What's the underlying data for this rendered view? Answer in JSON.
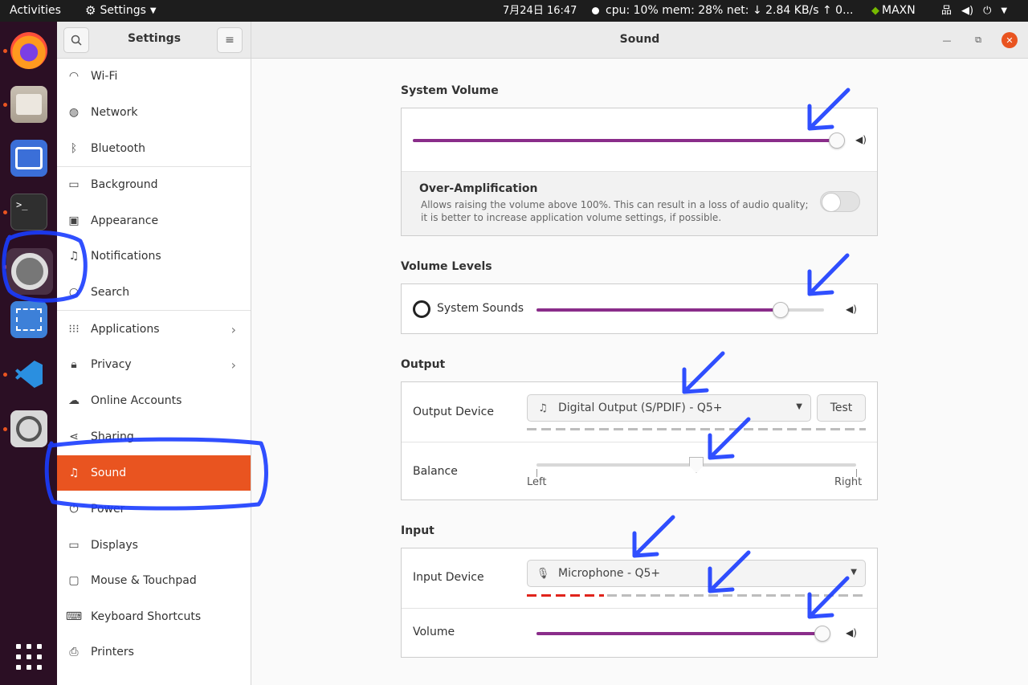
{
  "topbar": {
    "activities": "Activities",
    "app_menu": "Settings",
    "clock": "7月24日 16:47",
    "stats": "cpu: 10% mem: 28% net: ↓  2.84 KB/s ↑  0...",
    "gpu_label": "MAXN"
  },
  "dock": {
    "apps": [
      "firefox",
      "files",
      "workspaces",
      "terminal",
      "settings",
      "screenshot",
      "vscode",
      "magnifier"
    ],
    "terminal_glyph": ">_"
  },
  "sidebar": {
    "title": "Settings",
    "items": [
      {
        "label": "Wi-Fi",
        "icon": "wifi-icon"
      },
      {
        "label": "Network",
        "icon": "network-icon"
      },
      {
        "label": "Bluetooth",
        "icon": "bluetooth-icon"
      },
      {
        "label": "Background",
        "icon": "background-icon"
      },
      {
        "label": "Appearance",
        "icon": "appearance-icon"
      },
      {
        "label": "Notifications",
        "icon": "bell-icon"
      },
      {
        "label": "Search",
        "icon": "search-icon"
      },
      {
        "label": "Applications",
        "icon": "apps-icon"
      },
      {
        "label": "Privacy",
        "icon": "lock-icon"
      },
      {
        "label": "Online Accounts",
        "icon": "cloud-icon"
      },
      {
        "label": "Sharing",
        "icon": "share-icon"
      },
      {
        "label": "Sound",
        "icon": "music-icon"
      },
      {
        "label": "Power",
        "icon": "power-icon"
      },
      {
        "label": "Displays",
        "icon": "display-icon"
      },
      {
        "label": "Mouse & Touchpad",
        "icon": "mouse-icon"
      },
      {
        "label": "Keyboard Shortcuts",
        "icon": "keyboard-icon"
      },
      {
        "label": "Printers",
        "icon": "printer-icon"
      }
    ],
    "active": "Sound"
  },
  "header": {
    "title": "Sound"
  },
  "system_volume": {
    "title": "System Volume",
    "level_percent": 100,
    "over_amp_title": "Over-Amplification",
    "over_amp_desc": "Allows raising the volume above 100%. This can result in a loss of audio quality; it is better to increase application volume settings, if possible.",
    "over_amp_enabled": false
  },
  "volume_levels": {
    "title": "Volume Levels",
    "system_sounds_label": "System Sounds",
    "level_percent": 85
  },
  "output": {
    "title": "Output",
    "device_label": "Output Device",
    "device_value": "Digital Output (S/PDIF) - Q5+",
    "test_label": "Test",
    "balance_label": "Balance",
    "balance_left": "Left",
    "balance_right": "Right",
    "balance_percent": 50
  },
  "input": {
    "title": "Input",
    "device_label": "Input Device",
    "device_value": "Microphone - Q5+",
    "volume_label": "Volume",
    "level_percent": 100
  },
  "colors": {
    "accent": "#e95420",
    "slider_fill": "#8a2d8a",
    "annotation": "#1a3cff"
  }
}
